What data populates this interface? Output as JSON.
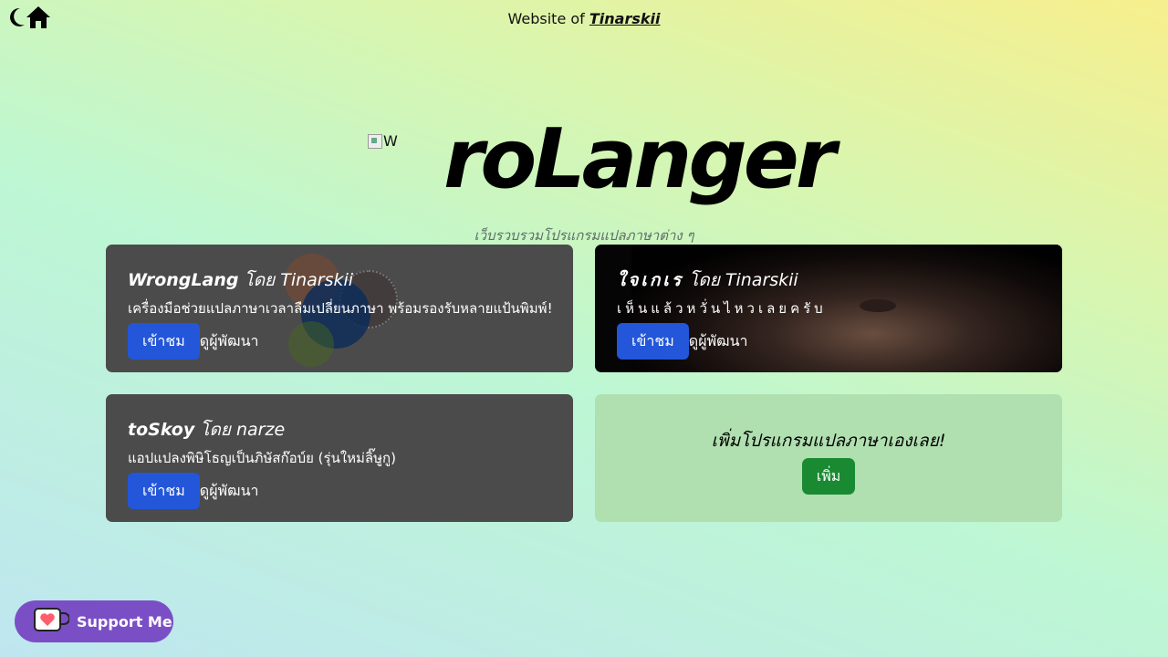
{
  "header": {
    "title_prefix": "Website of",
    "owner": "Tinarskii",
    "icons": [
      "moon-icon",
      "home-icon"
    ]
  },
  "hero": {
    "logo_alt": "W",
    "logo_text": "roLanger",
    "tagline": "เว็บรวบรวมโปรแกรมแปลภาษาต่าง ๆ"
  },
  "cards": [
    {
      "name": "WrongLang",
      "by": "โดย Tinarskii",
      "description": "เครื่องมือช่วยแปลภาษาเวลาลืมเปลี่ยนภาษา พร้อมรองรับหลายแป้นพิมพ์!",
      "visit_label": "เข้าชม",
      "dev_label": "ดูผู้พัฒนา"
    },
    {
      "name": "ใจเกเร",
      "by": "โดย Tinarskii",
      "description": "เห็นแล้วหวั่นไหวเลยครับ",
      "visit_label": "เข้าชม",
      "dev_label": "ดูผู้พัฒนา"
    },
    {
      "name": "toSkoy",
      "by": "โดย narze",
      "description": "แอปแปลงพิษิโธญเป็นภิษัสก๊อบ์ย (รุ่นใหม่ลิ๊ษูกู)",
      "visit_label": "เข้าชม",
      "dev_label": "ดูผู้พัฒนา"
    }
  ],
  "add_card": {
    "title": "เพิ่มโปรแกรมแปลภาษาเองเลย!",
    "button_label": "เพิ่ม"
  },
  "support": {
    "label": "Support Me"
  },
  "colors": {
    "card_bg": "#4b4b4b",
    "visit_button": "#2356d9",
    "add_button": "#1a8a32",
    "support_bg": "#7a4fc6"
  }
}
